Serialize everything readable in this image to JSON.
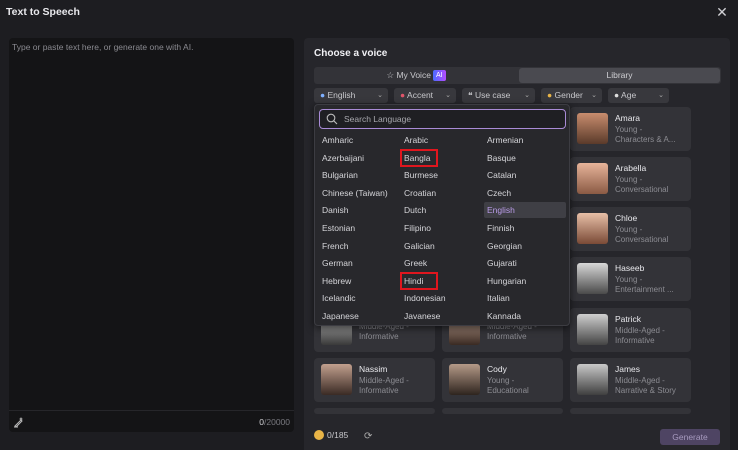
{
  "window": {
    "title": "Text to Speech"
  },
  "editor": {
    "placeholder": "Type or paste text here, or generate one with AI.",
    "count_used": "0",
    "count_total": "/20000"
  },
  "voice_panel": {
    "heading": "Choose a voice",
    "tabs": {
      "my_voice": "My Voice",
      "ai_badge": "AI",
      "library": "Library"
    },
    "filters": {
      "language": "English",
      "accent": "Accent",
      "use_case": "Use case",
      "gender": "Gender",
      "age": "Age"
    },
    "voices": [
      {
        "name": "Amara",
        "desc1": "Young -",
        "desc2": "Characters & A..."
      },
      {
        "name": "Arabella",
        "desc1": "Young -",
        "desc2": "Conversational"
      },
      {
        "name": "Chloe",
        "desc1": "Young -",
        "desc2": "Conversational"
      },
      {
        "name": "Haseeb",
        "desc1": "Young -",
        "desc2": "Entertainment ..."
      },
      {
        "name": "",
        "desc1": "Middle-Aged -",
        "desc2": "Informative"
      },
      {
        "name": "",
        "desc1": "Middle-Aged -",
        "desc2": "Informative"
      },
      {
        "name": "Patrick",
        "desc1": "Middle-Aged -",
        "desc2": "Informative"
      },
      {
        "name": "Nassim",
        "desc1": "Middle-Aged -",
        "desc2": "Informative"
      },
      {
        "name": "Cody",
        "desc1": "Young -",
        "desc2": "Educational"
      },
      {
        "name": "James",
        "desc1": "Middle-Aged -",
        "desc2": "Narrative & Story"
      }
    ],
    "credits": "0/185",
    "generate_label": "Generate"
  },
  "language_dropdown": {
    "search_placeholder": "Search Language",
    "selected": "English",
    "highlighted": [
      "Bangla",
      "Hindi"
    ],
    "col1": [
      "Amharic",
      "Azerbaijani",
      "Bulgarian",
      "Chinese (Taiwan)",
      "Danish",
      "Estonian",
      "French",
      "German",
      "Hebrew",
      "Icelandic",
      "Japanese"
    ],
    "col2": [
      "Arabic",
      "Bangla",
      "Burmese",
      "Croatian",
      "Dutch",
      "Filipino",
      "Galician",
      "Greek",
      "Hindi",
      "Indonesian",
      "Javanese"
    ],
    "col3": [
      "Armenian",
      "Basque",
      "Catalan",
      "Czech",
      "English",
      "Finnish",
      "Georgian",
      "Gujarati",
      "Hungarian",
      "Italian",
      "Kannada"
    ]
  },
  "colors": {
    "accent_purple": "#b99be8",
    "highlight_red": "#e0161e",
    "coin": "#e8b447"
  }
}
